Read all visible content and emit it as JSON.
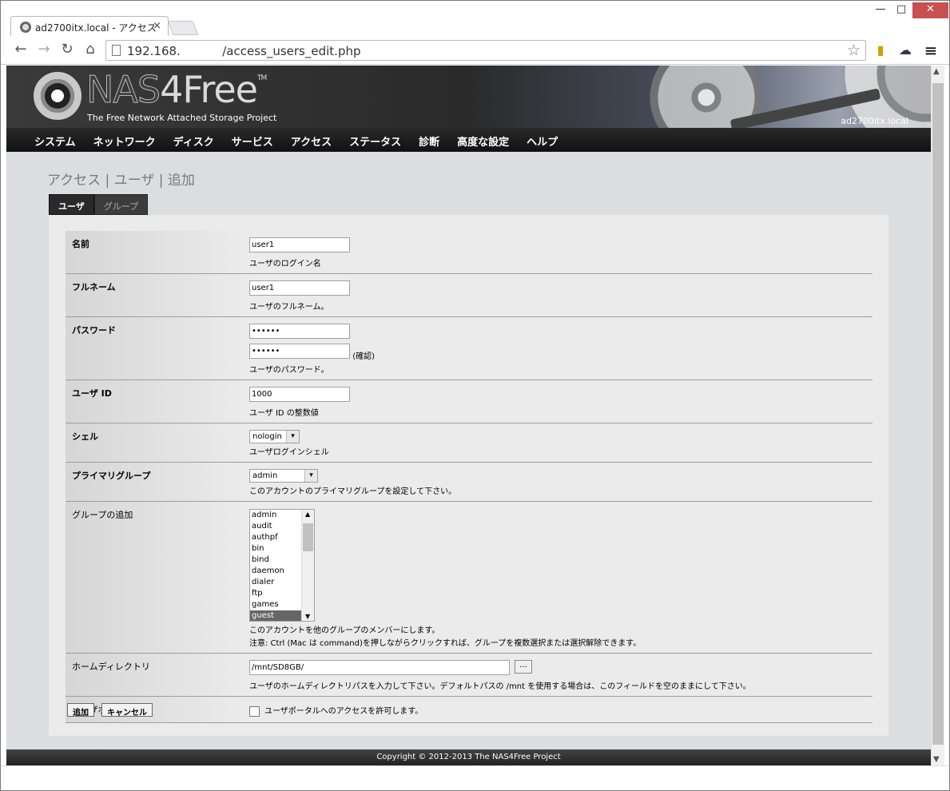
{
  "browser": {
    "tab_title": "ad2700itx.local - アクセス",
    "tab_close": "×",
    "url": "192.168.           /access_users_edit.php",
    "star_icon": "☆",
    "back_icon": "←",
    "forward_icon": "→",
    "reload_icon": "↻",
    "home_icon": "⌂",
    "menu_icon": "≡",
    "min_icon": "—",
    "max_icon": "□",
    "close_icon": "✕"
  },
  "header": {
    "brand_nas": "NAS",
    "brand_4free": "4Free",
    "brand_tm": "TM",
    "tagline": "The Free Network Attached Storage Project",
    "hostname": "ad2700itx.local"
  },
  "menu": [
    "システム",
    "ネットワーク",
    "ディスク",
    "サービス",
    "アクセス",
    "ステータス",
    "診断",
    "高度な設定",
    "ヘルプ"
  ],
  "page_title": "アクセス | ユーザ | 追加",
  "tabs": {
    "users": "ユーザ",
    "groups": "グループ"
  },
  "form": {
    "name": {
      "label": "名前",
      "value": "user1",
      "desc": "ユーザのログイン名"
    },
    "fullname": {
      "label": "フルネーム",
      "value": "user1",
      "desc": "ユーザのフルネーム。"
    },
    "password": {
      "label": "パスワード",
      "value": "••••••",
      "confirm_value": "••••••",
      "confirm_label": "(確認)",
      "desc": "ユーザのパスワード。"
    },
    "uid": {
      "label": "ユーザ ID",
      "value": "1000",
      "desc": "ユーザ ID の整数値"
    },
    "shell": {
      "label": "シェル",
      "value": "nologin",
      "desc": "ユーザログインシェル"
    },
    "primary_group": {
      "label": "プライマリグループ",
      "value": "admin",
      "desc": "このアカウントのプライマリグループを設定して下さい。"
    },
    "groups": {
      "label": "グループの追加",
      "options": [
        "admin",
        "audit",
        "authpf",
        "bin",
        "bind",
        "daemon",
        "dialer",
        "ftp",
        "games",
        "guest"
      ],
      "selected": "guest",
      "desc1": "このアカウントを他のグループのメンバーにします。",
      "desc2": "注意: Ctrl (Mac は command)を押しながらクリックすれば、グループを複数選択または選択解除できます。"
    },
    "homedir": {
      "label": "ホームディレクトリ",
      "value": "/mnt/SD8GB/",
      "browse": "...",
      "desc": "ユーザのホームディレクトリパスを入力して下さい。デフォルトパスの /mnt を使用する場合は、このフィールドを空のままにして下さい。"
    },
    "portal": {
      "label": "ユーザポータル",
      "checkbox_label": "ユーザポータルへのアクセスを許可します。",
      "checked": false
    }
  },
  "buttons": {
    "add": "追加",
    "cancel": "キャンセル"
  },
  "footer": "Copyright © 2012-2013 The NAS4Free Project"
}
